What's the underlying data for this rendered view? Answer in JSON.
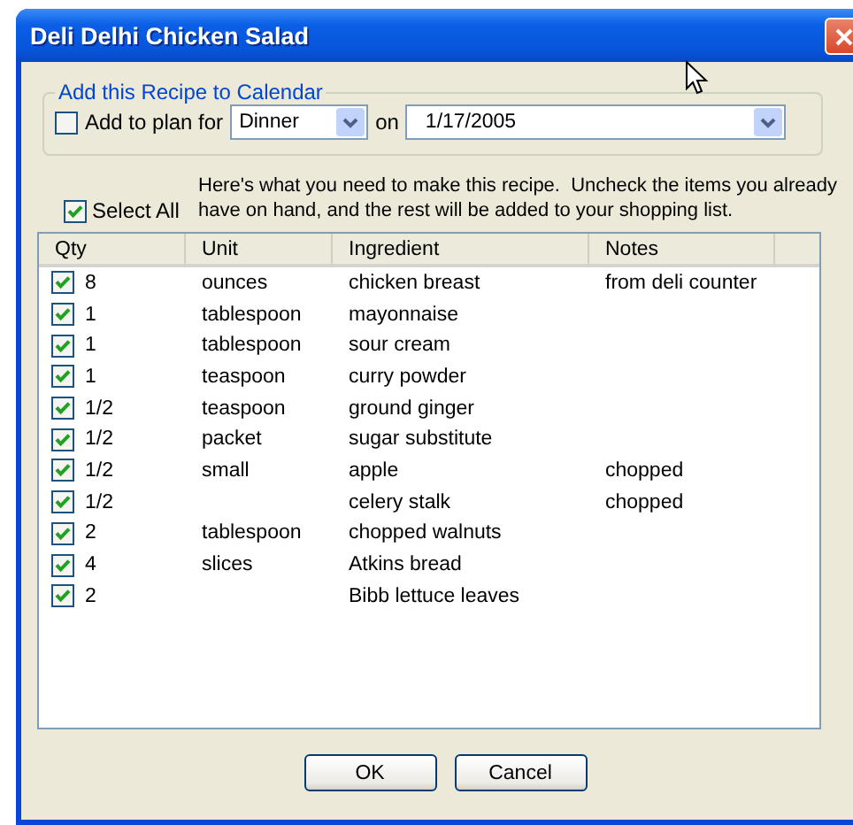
{
  "window": {
    "title": "Deli Delhi Chicken Salad"
  },
  "calendar": {
    "legend": "Add this Recipe to Calendar",
    "add_to_plan": {
      "label": "Add to plan for",
      "checked": false
    },
    "meal": "Dinner",
    "on_label": "on",
    "date": "1/17/2005"
  },
  "select_all": {
    "label": "Select All",
    "checked": true
  },
  "instructions": "Here's what you need to make this recipe.  Uncheck the items you already have on hand, and the rest will be added to your shopping list.",
  "columns": [
    "Qty",
    "Unit",
    "Ingredient",
    "Notes"
  ],
  "rows": [
    {
      "checked": true,
      "qty": "8",
      "unit": "ounces",
      "ingredient": "chicken breast",
      "notes": "from deli counter"
    },
    {
      "checked": true,
      "qty": "1",
      "unit": "tablespoon",
      "ingredient": "mayonnaise"
    },
    {
      "checked": true,
      "qty": "1",
      "unit": "tablespoon",
      "ingredient": "sour cream"
    },
    {
      "checked": true,
      "qty": "1",
      "unit": "teaspoon",
      "ingredient": "curry powder"
    },
    {
      "checked": true,
      "qty": "1/2",
      "unit": "teaspoon",
      "ingredient": "ground ginger"
    },
    {
      "checked": true,
      "qty": "1/2",
      "unit": "packet",
      "ingredient": "sugar substitute"
    },
    {
      "checked": true,
      "qty": "1/2",
      "unit": "small",
      "ingredient": "apple",
      "notes": "chopped"
    },
    {
      "checked": true,
      "qty": "1/2",
      "ingredient": "celery stalk",
      "notes": "chopped"
    },
    {
      "checked": true,
      "qty": "2",
      "unit": "tablespoon",
      "ingredient": "chopped walnuts"
    },
    {
      "checked": true,
      "qty": "4",
      "unit": "slices",
      "ingredient": "Atkins bread"
    },
    {
      "checked": true,
      "qty": "2",
      "ingredient": "Bibb lettuce leaves"
    }
  ],
  "buttons": [
    "OK",
    "Cancel"
  ]
}
